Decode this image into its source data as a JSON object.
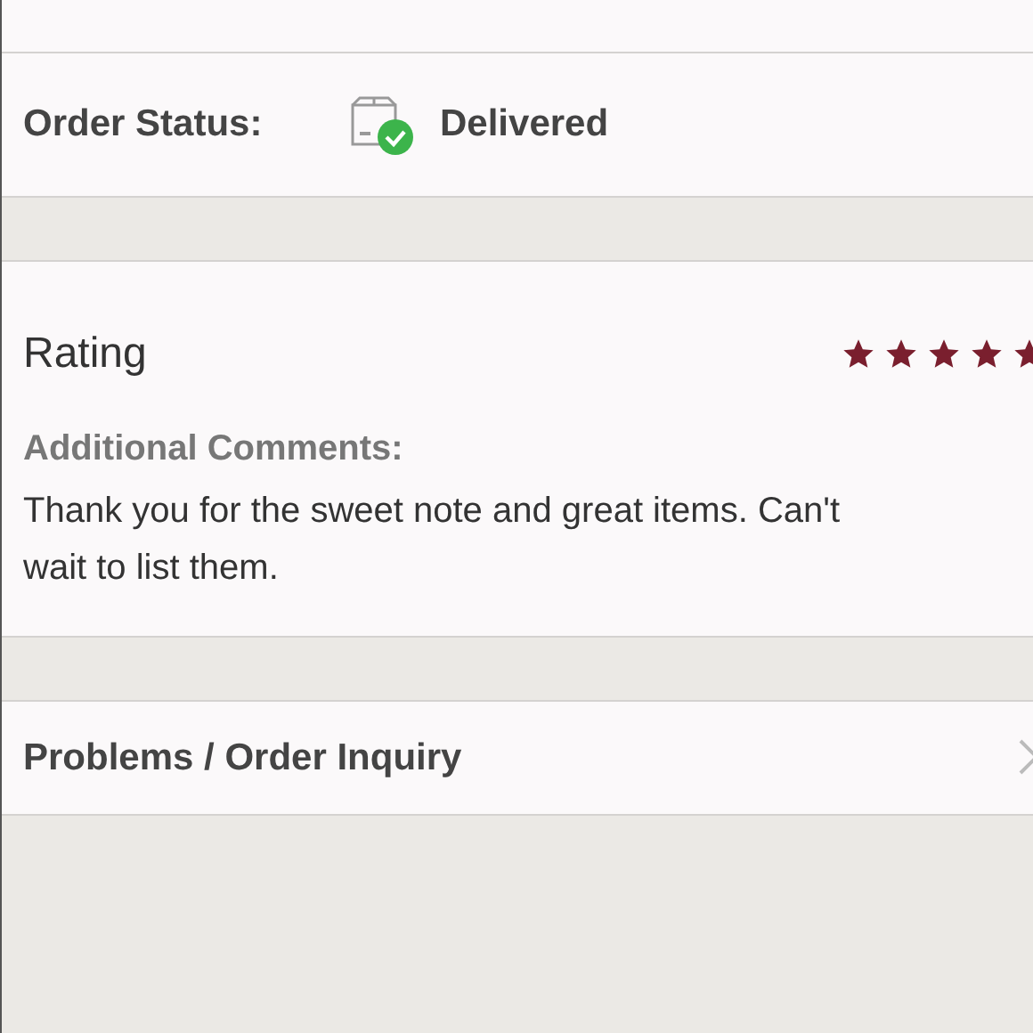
{
  "order_status": {
    "label": "Order Status:",
    "value": "Delivered"
  },
  "rating": {
    "title": "Rating",
    "stars": 5,
    "comments_label": "Additional Comments:",
    "comments": "Thank you for the sweet note and great items. Can't wait to list them."
  },
  "inquiry": {
    "label": "Problems / Order Inquiry"
  }
}
